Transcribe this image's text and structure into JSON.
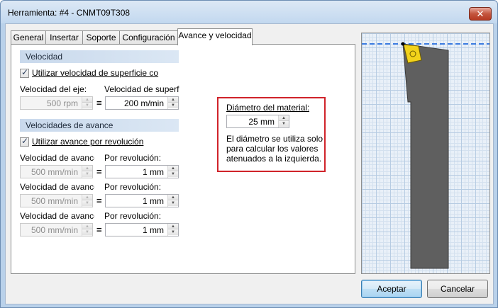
{
  "window": {
    "title": "Herramienta: #4 - CNMT09T308",
    "close_glyph": "✕"
  },
  "tabs": [
    {
      "label": "General"
    },
    {
      "label": "Insertar"
    },
    {
      "label": "Soporte"
    },
    {
      "label": "Configuración"
    },
    {
      "label": "Avance y velocidad"
    }
  ],
  "velocidad": {
    "header": "Velocidad",
    "use_surface_speed_label": "Utilizar velocidad de superficie co",
    "spindle_speed_label": "Velocidad del eje:",
    "surface_speed_label": "Velocidad de superficie",
    "spindle_speed_value": "500 rpm",
    "surface_speed_value": "200 m/min",
    "equals": "="
  },
  "avance": {
    "header": "Velocidades de avance",
    "use_per_rev_label": "Utilizar avance por revolución",
    "rows": [
      {
        "feed_label": "Velocidad de avance c",
        "per_rev_label": "Por revolución:",
        "feed_value": "500 mm/min",
        "per_rev_value": "1 mm"
      },
      {
        "feed_label": "Velocidad de avance c",
        "per_rev_label": "Por revolución:",
        "feed_value": "500 mm/min",
        "per_rev_value": "1 mm"
      },
      {
        "feed_label": "Velocidad de avance c",
        "per_rev_label": "Por revolución:",
        "feed_value": "500 mm/min",
        "per_rev_value": "1 mm"
      }
    ]
  },
  "diametro": {
    "label": "Diámetro del material:",
    "value": "25 mm",
    "note": "El diámetro se utiliza solo\npara calcular los valores\natenuados a la izquierda."
  },
  "buttons": {
    "accept": "Aceptar",
    "cancel": "Cancelar"
  },
  "colors": {
    "highlight_border": "#d0232a",
    "tool_body": "#5f5f5f",
    "insert": "#f2d21b",
    "centerline": "#3a7be0"
  },
  "icons": {
    "spin_up": "▲",
    "spin_down": "▼",
    "check": "✓"
  }
}
